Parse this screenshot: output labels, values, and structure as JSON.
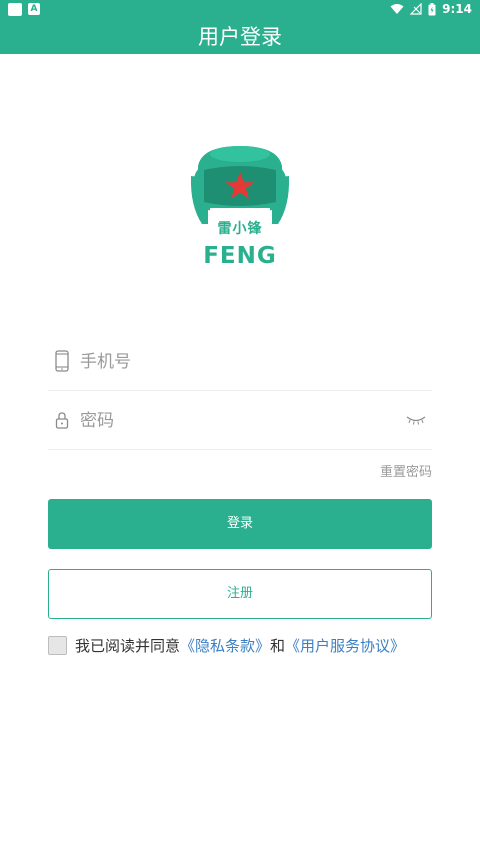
{
  "status_bar": {
    "time": "9:14",
    "notification_icon_letter": "A"
  },
  "header": {
    "title": "用户登录"
  },
  "logo": {
    "badge_text": "雷小锋",
    "brand_text": "FENG",
    "colors": {
      "hat": "#2bb08f",
      "hat_dark": "#1f8f73",
      "star": "#e53935",
      "face": "#ffffff"
    }
  },
  "form": {
    "phone_placeholder": "手机号",
    "password_placeholder": "密码",
    "reset_password_label": "重置密码",
    "login_label": "登录",
    "register_label": "注册"
  },
  "agreement": {
    "prefix": "我已阅读并同意",
    "privacy_link": "《隐私条款》",
    "conjunction": "和",
    "service_link": "《用户服务协议》",
    "checked": false
  },
  "colors": {
    "accent": "#2bb08f",
    "link": "#3b7fc4",
    "muted": "#9a9a9a"
  }
}
